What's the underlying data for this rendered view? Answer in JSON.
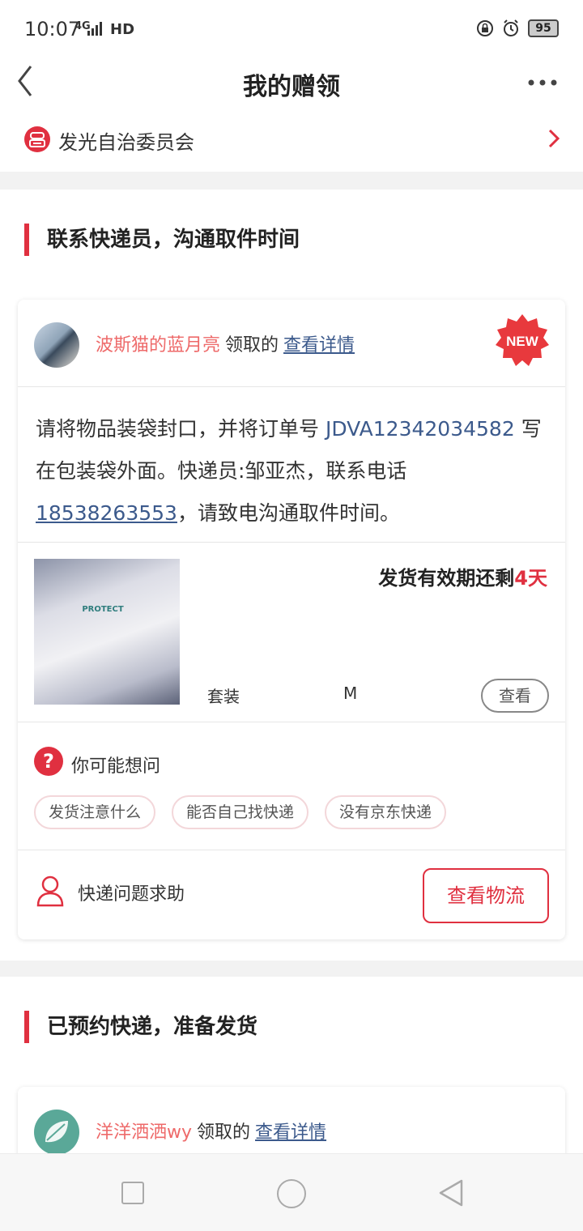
{
  "status_bar": {
    "time": "10:07",
    "network": "4G",
    "hd": "HD",
    "battery": "95"
  },
  "nav": {
    "title": "我的赠领"
  },
  "group": {
    "name": "发光自治委员会"
  },
  "sections": [
    {
      "title": "联系快递员，沟通取件时间",
      "card": {
        "user_name": "波斯猫的蓝月亮",
        "received_label": "领取的",
        "detail_link": "查看详情",
        "badge": "NEW",
        "message": {
          "part1": "请将物品装袋封口，并将订单号",
          "order_no": "JDVA12342034582",
          "part2": "写在包装袋外面。快递员:邹亚杰，联系电话",
          "phone": "18538263553",
          "part3": "，请致电沟通取件时间。"
        },
        "item": {
          "print_text": "PROTECT",
          "deadline_prefix": "发货有效期还剩",
          "deadline_days": "4天",
          "type": "套装",
          "size": "M",
          "view_label": "查看"
        },
        "faq": {
          "icon": "?",
          "title": "你可能想问",
          "chips": [
            "发货注意什么",
            "能否自己找快递",
            "没有京东快递"
          ]
        },
        "footer": {
          "help_text": "快递问题求助",
          "logistics_label": "查看物流"
        }
      }
    },
    {
      "title": "已预约快递，准备发货",
      "card": {
        "user_name": "洋洋洒洒wy",
        "received_label": "领取的",
        "detail_link": "查看详情"
      }
    }
  ],
  "colors": {
    "accent": "#e03040",
    "link": "#3c5a8c",
    "username": "#ee6a6a"
  }
}
